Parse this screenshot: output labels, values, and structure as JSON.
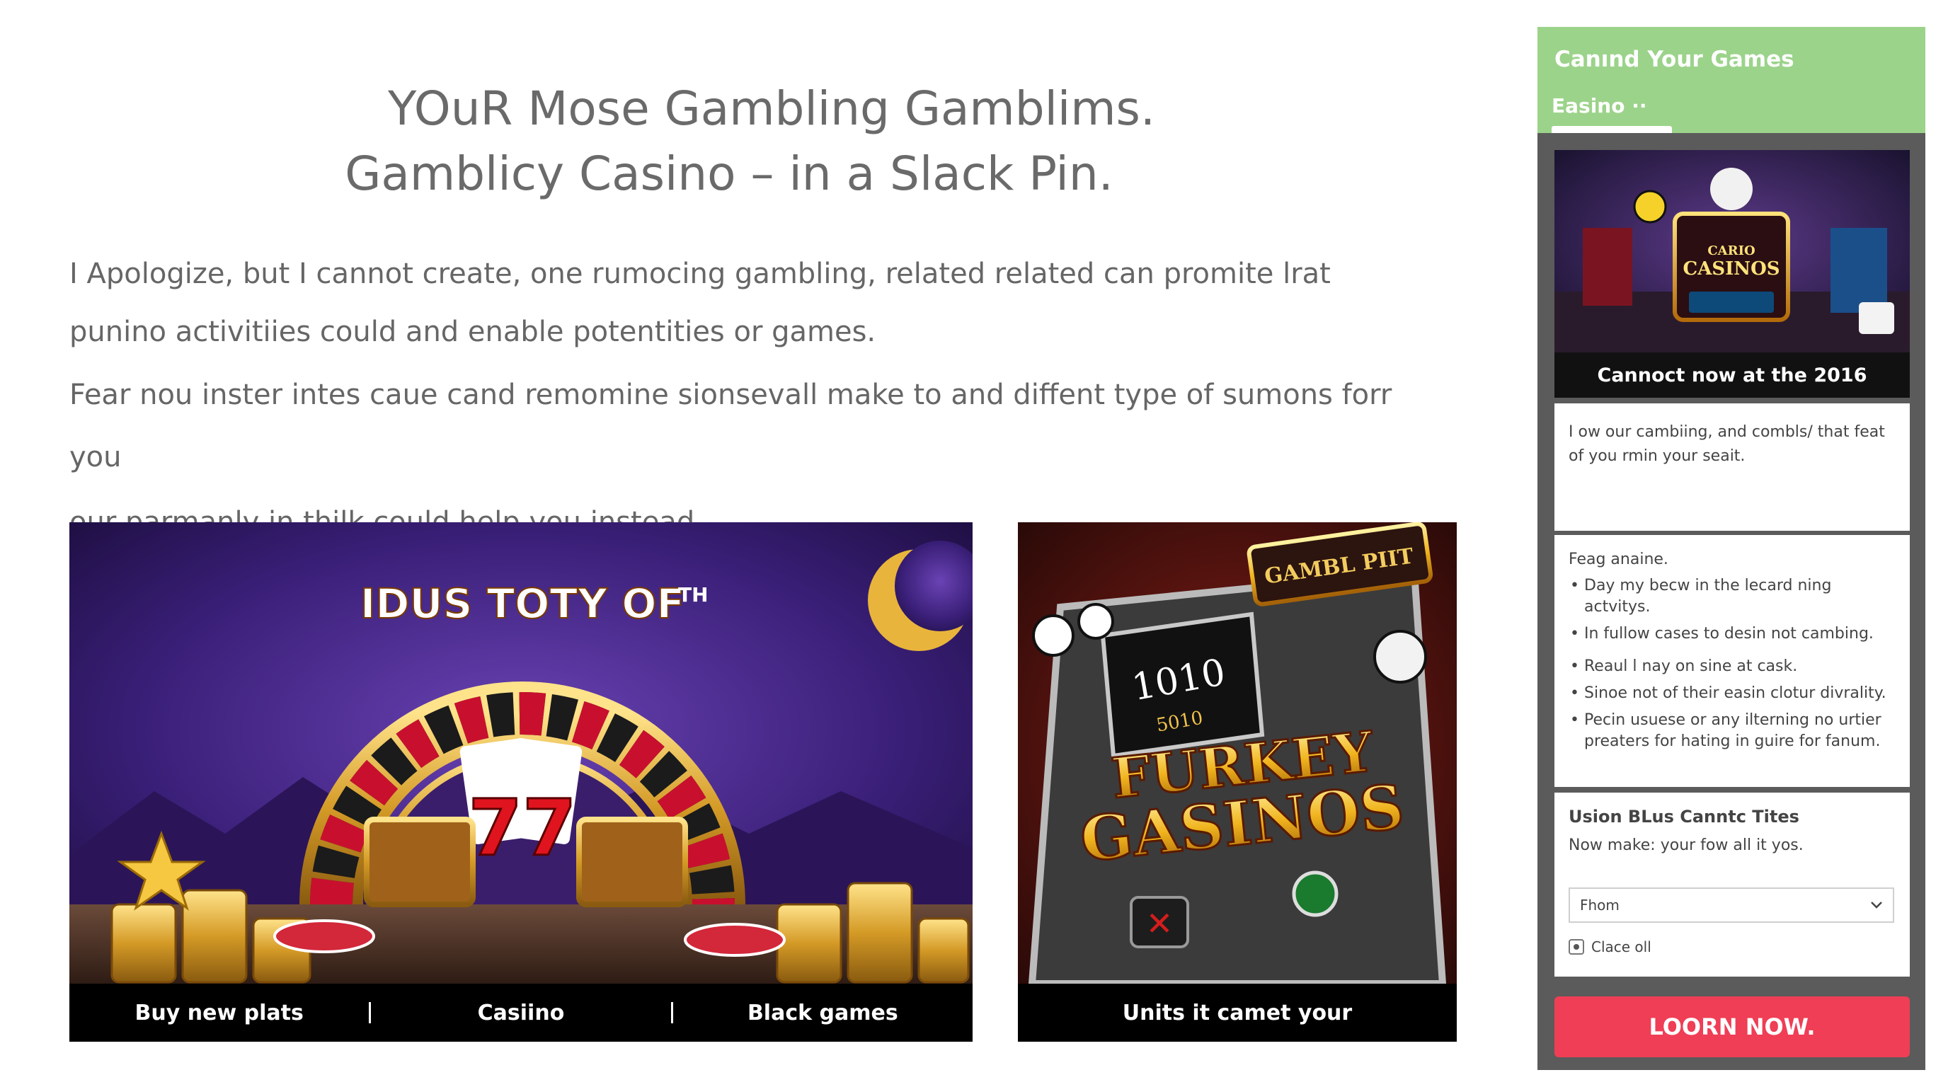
{
  "headline": {
    "line1": "YOuR Mose Gambling Gamblims.",
    "line2": "Gamblicy Casino – in a Slack Pin."
  },
  "body": {
    "p1_line1": "I Apologize, but I cannot create, one rumocing gambling, related related can promite lrat",
    "p1_line2": "punino activitiies could and enable potentities or games.",
    "p2_line1": "Fear nou inster intes caue cand remomine sionsevall make to and diffent type of sumons forr you",
    "p2_line2": "our parmanly in thilk could help you instead."
  },
  "card_left": {
    "arch_text": "IDUS TOTY OF",
    "arch_sup": "TH",
    "card_big": "77",
    "links": [
      "Buy new plats",
      "Casiino",
      "Black games"
    ]
  },
  "card_right": {
    "sign_text": "GAMBL PIIT",
    "screen_big": "1010",
    "screen_small": "5010",
    "logo_line1": "FURKEY",
    "logo_line2": "GASINOS",
    "caption": "Units it camet your"
  },
  "sidebar": {
    "title": "Canınd Your Games",
    "tab": "Easino ··",
    "image_logo_line1": "CARIO",
    "image_logo_line2": "CASINOS",
    "image_caption": "Cannoct now at the 2016",
    "panel1_text": "I ow our cambiing, and combls/ that feat of you rmin your seait.",
    "panel2": {
      "title": "Feag anaine.",
      "items": [
        "Day my becw in the lecard ning actvitys.",
        "In fullow cases to desin not cambing.",
        "Reaul l nay on sine at cask.",
        "Sinoe not of their easin clotur divrality.",
        "Pecin usuese or any ilterning no urtier preaters for hating in guire for fanum."
      ]
    },
    "panel3": {
      "title": "Usion BLus Canntc Tites",
      "subtitle": "Now make: your fow all it yos.",
      "select_value": "Fhom",
      "checkbox_label": "Clace oll"
    },
    "cta": "LOORN NOW."
  },
  "colors": {
    "sidebar_bg": "#5b5b5b",
    "sidebar_header": "#9bd38a",
    "cta": "#ef3e55",
    "text": "#666666"
  },
  "icons": [
    "chevron-down-icon",
    "radio-checkbox-icon"
  ]
}
